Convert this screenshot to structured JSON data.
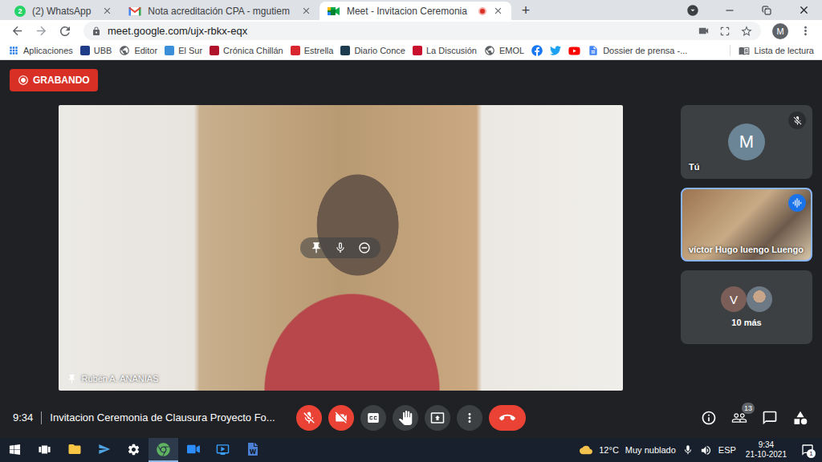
{
  "browser": {
    "tabs": [
      {
        "title": "(2) WhatsApp",
        "kind": "whatsapp",
        "badge": "2",
        "selected": false,
        "recording": false
      },
      {
        "title": "Nota acreditación CPA - mgutiem",
        "kind": "gmail",
        "selected": false,
        "recording": false
      },
      {
        "title": "Meet - Invitacion Ceremonia",
        "kind": "meet",
        "selected": true,
        "recording": true
      }
    ],
    "new_tab": "+",
    "url": "meet.google.com/ujx-rbkx-eqx",
    "profile": "M",
    "bookmarks": [
      {
        "label": "Aplicaciones",
        "kind": "apps"
      },
      {
        "label": "UBB",
        "kind": "site",
        "color": "#1f3c88"
      },
      {
        "label": "Editor",
        "kind": "web"
      },
      {
        "label": "El Sur",
        "kind": "site",
        "color": "#3b8fd9"
      },
      {
        "label": "Crónica Chillán",
        "kind": "site",
        "color": "#b0122b"
      },
      {
        "label": "Estrella",
        "kind": "site",
        "color": "#d7262e"
      },
      {
        "label": "Diario Conce",
        "kind": "site",
        "color": "#1d3b4f"
      },
      {
        "label": "La Discusión",
        "kind": "site",
        "color": "#c8102e"
      },
      {
        "label": "EMOL",
        "kind": "web"
      }
    ],
    "social_links": [
      {
        "kind": "facebook"
      },
      {
        "kind": "twitter"
      },
      {
        "kind": "youtube"
      }
    ],
    "bookmarks_more": [
      {
        "label": "Dossier de prensa -...",
        "kind": "doc"
      }
    ],
    "reading_list": "Lista de lectura"
  },
  "meet": {
    "recording_badge": "GRABANDO",
    "main_tile": {
      "name": "Rubén A. ANANIAS",
      "pinned": true
    },
    "side_tiles": [
      {
        "kind": "avatar",
        "initial": "M",
        "name": "Tú",
        "muted": true,
        "speaking": false
      },
      {
        "kind": "video",
        "name": "víctor Hugo luengo Luengo",
        "muted": false,
        "speaking": true
      },
      {
        "kind": "more",
        "initial": "V",
        "name": "10 más",
        "muted": false,
        "speaking": false
      }
    ],
    "time": "9:34",
    "meeting_title": "Invitacion Ceremonia de Clausura Proyecto Fo...",
    "controls": [
      {
        "kind": "mic",
        "off": true
      },
      {
        "kind": "camera",
        "off": true
      },
      {
        "kind": "captions",
        "off": false
      },
      {
        "kind": "hand",
        "off": false
      },
      {
        "kind": "present",
        "off": false
      },
      {
        "kind": "more",
        "off": false
      },
      {
        "kind": "end",
        "off": false
      }
    ],
    "actions": [
      {
        "kind": "info"
      },
      {
        "kind": "people",
        "badge": "13"
      },
      {
        "kind": "chat"
      },
      {
        "kind": "activities"
      }
    ]
  },
  "taskbar": {
    "apps": [
      {
        "kind": "start",
        "selected": false
      },
      {
        "kind": "taskview",
        "selected": false
      },
      {
        "kind": "explorer",
        "selected": false
      },
      {
        "kind": "app",
        "selected": false
      },
      {
        "kind": "settings",
        "selected": false
      },
      {
        "kind": "chrome",
        "selected": true
      },
      {
        "kind": "zoom",
        "selected": false
      },
      {
        "kind": "media",
        "selected": false
      },
      {
        "kind": "word",
        "selected": false
      }
    ],
    "weather": {
      "temp": "12°C",
      "desc": "Muy nublado"
    },
    "language": "ESP",
    "time": "9:34",
    "date": "21-10-2021",
    "notifications": "1"
  }
}
